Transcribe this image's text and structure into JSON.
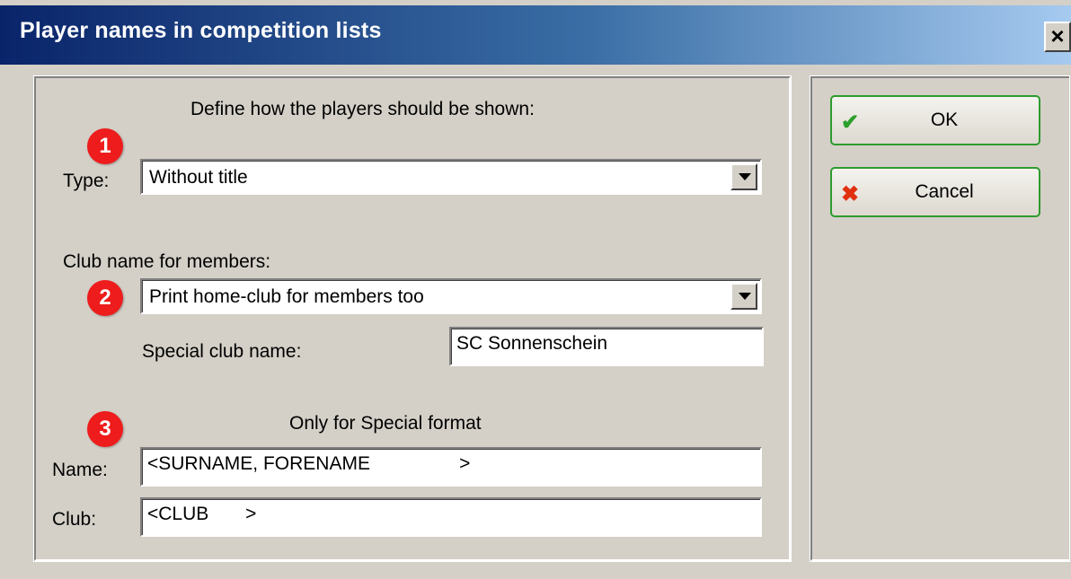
{
  "window": {
    "title": "Player names in competition lists",
    "close_label": "×"
  },
  "form": {
    "heading": "Define how the players should be shown:",
    "type_label": "Type:",
    "type_value": "Without title",
    "club_section_label": "Club name for members:",
    "club_option_value": "Print home-club for members too",
    "special_club_label": "Special club name:",
    "special_club_value": "SC Sonnenschein",
    "special_format_heading": "Only for Special format",
    "name_label": "Name:",
    "name_value": "<SURNAME, FORENAME                 >",
    "club_label": "Club:",
    "club_value": "<CLUB       >"
  },
  "badges": [
    "1",
    "2",
    "3"
  ],
  "buttons": {
    "ok_label": "OK",
    "cancel_label": "Cancel",
    "ok_icon": "checkmark-icon",
    "cancel_icon": "x-icon"
  },
  "colors": {
    "title_start": "#0a246a",
    "title_end": "#a6caf0",
    "badge": "#ee1c1c",
    "button_border": "#2d9b2d"
  }
}
